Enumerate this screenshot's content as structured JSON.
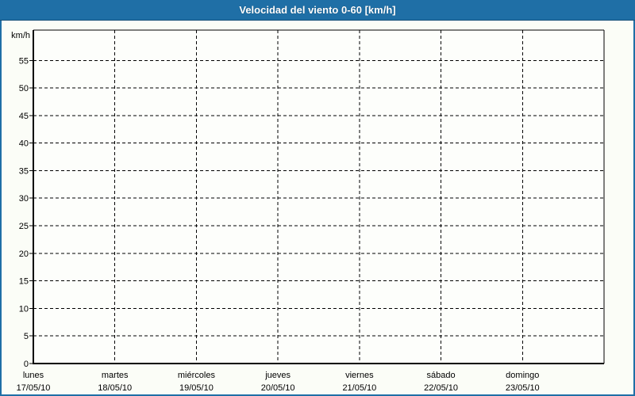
{
  "chart_data": {
    "type": "line",
    "title": "Velocidad del viento 0-60 [km/h]",
    "ylabel": "km/h",
    "ylim": [
      0,
      60.5
    ],
    "yticks": [
      0,
      5,
      10,
      15,
      20,
      25,
      30,
      35,
      40,
      45,
      50,
      55
    ],
    "grid": "dashed-black-on",
    "legend": "none",
    "x_categories": [
      {
        "day": "lunes",
        "date": "17/05/10"
      },
      {
        "day": "martes",
        "date": "18/05/10"
      },
      {
        "day": "miércoles",
        "date": "19/05/10"
      },
      {
        "day": "jueves",
        "date": "20/05/10"
      },
      {
        "day": "viernes",
        "date": "21/05/10"
      },
      {
        "day": "sábado",
        "date": "22/05/10"
      },
      {
        "day": "domingo",
        "date": "23/05/10"
      }
    ],
    "series": []
  },
  "colors": {
    "header_bg": "#1f6fa6",
    "header_text": "#ffffff",
    "frame_border": "#1f6fa6",
    "page_bg": "#fbfdf7",
    "plot_bg": "#fdfefb",
    "axis": "#000000",
    "grid": "#000000",
    "label_text": "#000000"
  }
}
